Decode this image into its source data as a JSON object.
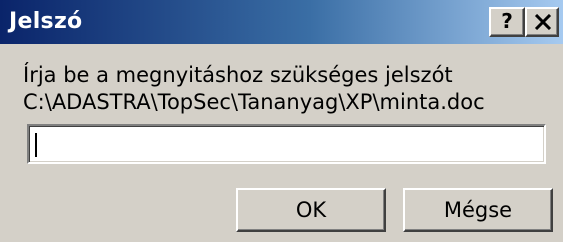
{
  "window": {
    "title": "Jelszó",
    "help_label": "?",
    "close_label": "close"
  },
  "dialog": {
    "prompt_line1": "Írja be a megnyitáshoz szükséges jelszót",
    "prompt_line2": "C:\\ADASTRA\\TopSec\\Tananyag\\XP\\minta.doc",
    "password_value": "",
    "ok_label": "OK",
    "cancel_label": "Mégse"
  },
  "colors": {
    "title_gradient_start": "#0a246a",
    "title_gradient_end": "#a6caf0",
    "face": "#d4d0c8"
  }
}
